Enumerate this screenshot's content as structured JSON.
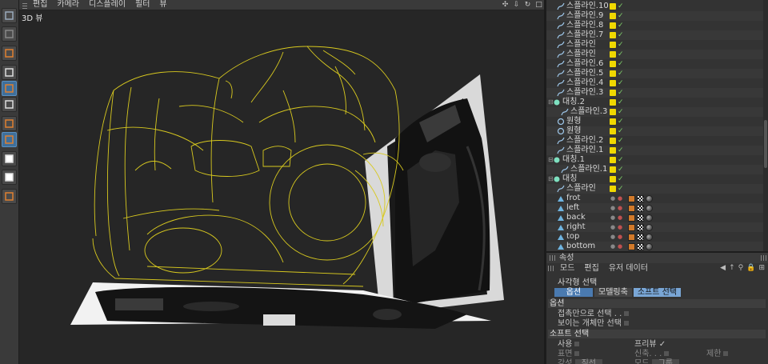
{
  "viewport": {
    "menu": [
      "편집",
      "카메라",
      "디스플레이",
      "필터",
      "뷰"
    ],
    "label": "3D 뷰",
    "controls": [
      "move-icon",
      "down-arrow-icon",
      "rotate-icon",
      "maximize-icon"
    ]
  },
  "toolbar": {
    "tools": [
      "live-select-icon",
      "brush-select-icon",
      "move-tool-icon",
      "axis-icon",
      "polygon-mode-icon",
      "uv-grid-icon",
      "texture-icon",
      "object-mode-icon",
      "checker-icon",
      "checker-small-icon",
      "sphere-edit-icon"
    ]
  },
  "object_manager": {
    "rows": [
      {
        "label": "스플라인.10",
        "kind": "spline",
        "indent": 1
      },
      {
        "label": "스플라인.9",
        "kind": "spline",
        "indent": 1
      },
      {
        "label": "스플라인.8",
        "kind": "spline",
        "indent": 1
      },
      {
        "label": "스플라인.7",
        "kind": "spline",
        "indent": 1
      },
      {
        "label": "스플라인",
        "kind": "spline",
        "indent": 1
      },
      {
        "label": "스플라인",
        "kind": "spline",
        "indent": 1
      },
      {
        "label": "스플라인.6",
        "kind": "spline",
        "indent": 1
      },
      {
        "label": "스플라인.5",
        "kind": "spline",
        "indent": 1
      },
      {
        "label": "스플라인.4",
        "kind": "spline",
        "indent": 1
      },
      {
        "label": "스플라인.3",
        "kind": "spline",
        "indent": 1
      },
      {
        "label": "대칭.2",
        "kind": "symmetry",
        "indent": 0
      },
      {
        "label": "스플라인.3",
        "kind": "spline",
        "indent": 2
      },
      {
        "label": "원형",
        "kind": "circle",
        "indent": 1
      },
      {
        "label": "원형",
        "kind": "circle",
        "indent": 1
      },
      {
        "label": "스플라인.2",
        "kind": "spline",
        "indent": 1
      },
      {
        "label": "스플라인.1",
        "kind": "spline",
        "indent": 1
      },
      {
        "label": "대칭.1",
        "kind": "symmetry",
        "indent": 0
      },
      {
        "label": "스플라인.1",
        "kind": "spline",
        "indent": 2
      },
      {
        "label": "대칭",
        "kind": "symmetry",
        "indent": 0
      },
      {
        "label": "스플라인",
        "kind": "spline",
        "indent": 1
      },
      {
        "label": "frot",
        "kind": "plane",
        "indent": 1
      },
      {
        "label": "left",
        "kind": "plane",
        "indent": 1
      },
      {
        "label": "back",
        "kind": "plane",
        "indent": 1
      },
      {
        "label": "right",
        "kind": "plane",
        "indent": 1
      },
      {
        "label": "top",
        "kind": "plane",
        "indent": 1
      },
      {
        "label": "bottom",
        "kind": "plane",
        "indent": 1
      }
    ]
  },
  "attribute_manager": {
    "title": "속성",
    "menu": [
      "모드",
      "편집",
      "유저 데이터"
    ],
    "object_title": "사각형 선택",
    "tabs": [
      "옵션",
      "모델링축",
      "소프트 선택"
    ],
    "options_header": "옵션",
    "option1": "접촉만으로 선택 . .",
    "option2": "보이는 개체만 선택",
    "soft_header": "소프트 선택",
    "use_label": "사용",
    "preview_label": "프리뷰",
    "preview_check": "✓",
    "surface_label": "표면",
    "rubber_label": "신축. . .",
    "limit_label": "제한",
    "radius_label": "강성",
    "radius_value": "직선",
    "mode_label": "모드",
    "mode_value": "그룹"
  }
}
